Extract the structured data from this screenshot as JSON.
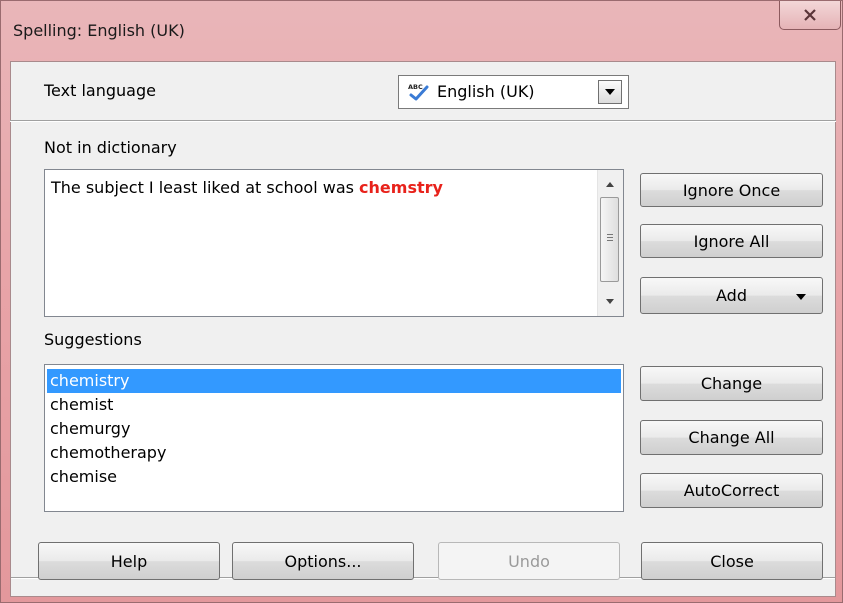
{
  "window": {
    "title": "Spelling: English (UK)"
  },
  "text_language": {
    "label": "Text language",
    "value": "English (UK)",
    "icon": "abc-spellcheck-icon"
  },
  "not_in_dictionary": {
    "label": "Not in dictionary",
    "sentence_prefix": "The subject I least liked at school was ",
    "error_word": "chemstry",
    "error_color": "#e8221b"
  },
  "suggestions": {
    "label": "Suggestions",
    "items": [
      "chemistry",
      "chemist",
      "chemurgy",
      "chemotherapy",
      "chemise"
    ],
    "selected": "chemistry",
    "selection_color": "#3399ff"
  },
  "buttons": {
    "ignore_once": "Ignore Once",
    "ignore_all": "Ignore All",
    "add": "Add",
    "change": "Change",
    "change_all": "Change All",
    "autocorrect": "AutoCorrect",
    "help": "Help",
    "options": "Options...",
    "undo": "Undo",
    "close": "Close"
  },
  "theme": {
    "titlebar_color": "#e8a4a8",
    "dialog_bg": "#f0f0f0"
  }
}
